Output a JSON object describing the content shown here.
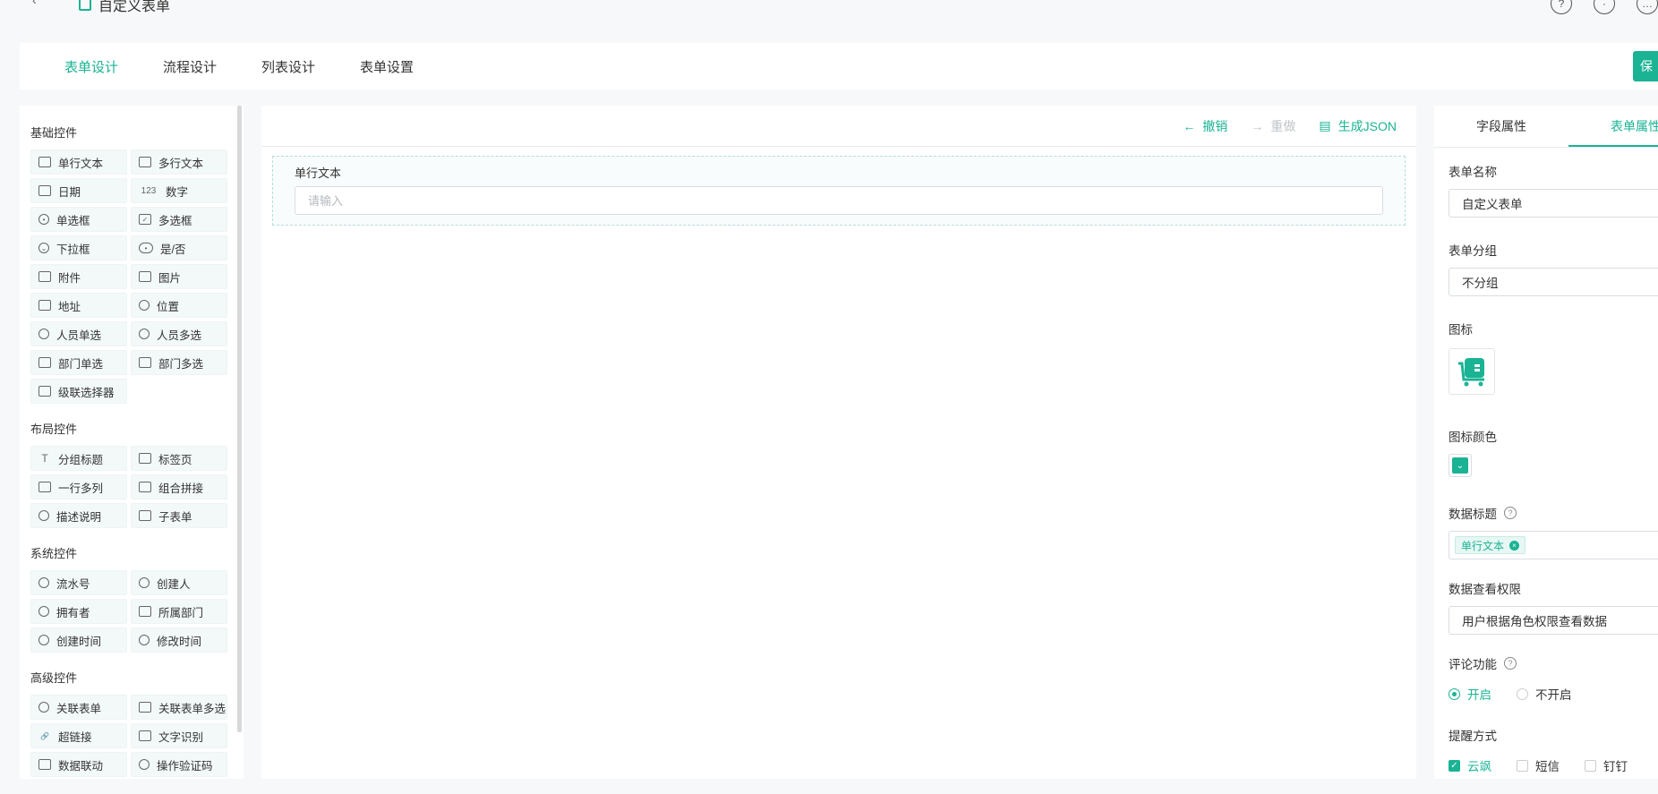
{
  "header": {
    "title": "自定义表单"
  },
  "nav": {
    "tabs": [
      "表单设计",
      "流程设计",
      "列表设计",
      "表单设置"
    ],
    "active_index": 0,
    "save_label": "保"
  },
  "palette": {
    "groups": [
      {
        "title": "基础控件",
        "items": [
          "单行文本",
          "多行文本",
          "日期",
          "数字",
          "单选框",
          "多选框",
          "下拉框",
          "是/否",
          "附件",
          "图片",
          "地址",
          "位置",
          "人员单选",
          "人员多选",
          "部门单选",
          "部门多选",
          "级联选择器"
        ]
      },
      {
        "title": "布局控件",
        "items": [
          "分组标题",
          "标签页",
          "一行多列",
          "组合拼接",
          "描述说明",
          "子表单"
        ]
      },
      {
        "title": "系统控件",
        "items": [
          "流水号",
          "创建人",
          "拥有者",
          "所属部门",
          "创建时间",
          "修改时间"
        ]
      },
      {
        "title": "高级控件",
        "items": [
          "关联表单",
          "关联表单多选",
          "超链接",
          "文字识别",
          "数据联动",
          "操作验证码"
        ]
      }
    ]
  },
  "canvas": {
    "toolbar": {
      "undo": "撤销",
      "redo": "重做",
      "gen_json": "生成JSON"
    },
    "field": {
      "label": "单行文本",
      "placeholder": "请输入"
    }
  },
  "props": {
    "tabs": [
      "字段属性",
      "表单属性"
    ],
    "active_index": 1,
    "form_name_label": "表单名称",
    "form_name_value": "自定义表单",
    "form_group_label": "表单分组",
    "form_group_value": "不分组",
    "icon_label": "图标",
    "icon_color_label": "图标颜色",
    "icon_color": "#1ab394",
    "data_title_label": "数据标题",
    "data_title_tag": "单行文本",
    "view_perm_label": "数据查看权限",
    "view_perm_value": "用户根据角色权限查看数据",
    "comment_label": "评论功能",
    "comment_on": "开启",
    "comment_off": "不开启",
    "remind_label": "提醒方式",
    "remind_options": [
      "云飒",
      "短信",
      "钉钉"
    ]
  },
  "colors": {
    "accent": "#1ab394"
  }
}
